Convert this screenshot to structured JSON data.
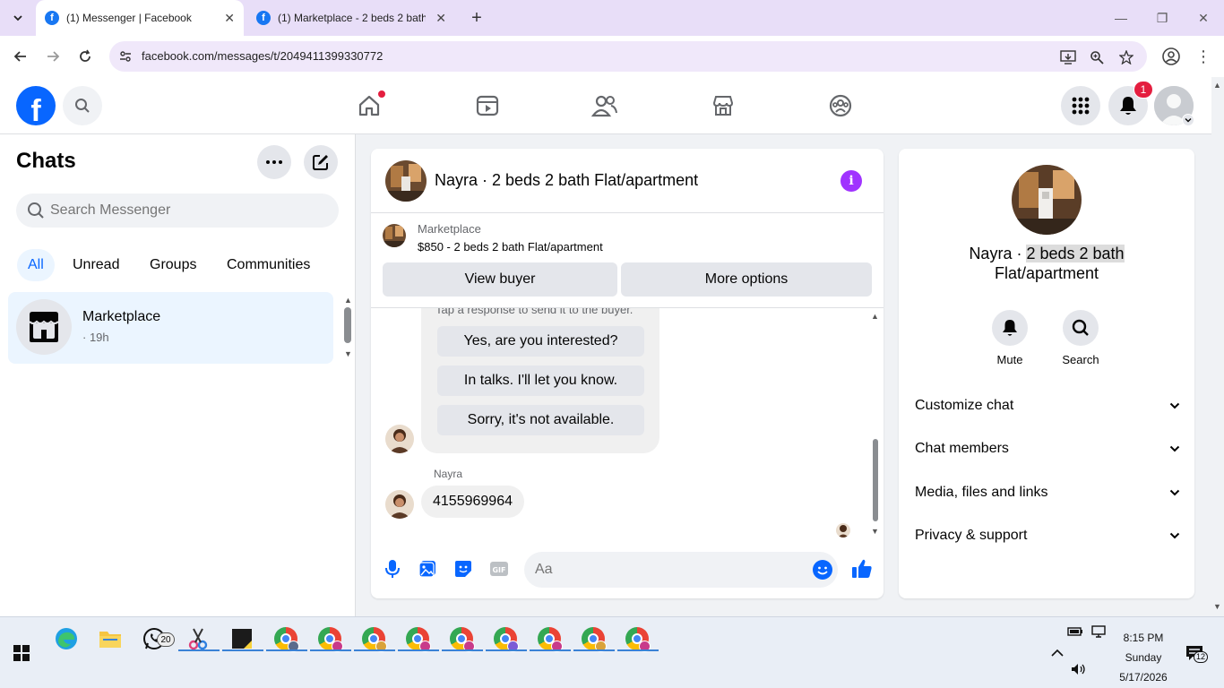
{
  "browser": {
    "tabs": [
      {
        "title": "(1) Messenger | Facebook",
        "active": true
      },
      {
        "title": "(1) Marketplace - 2 beds 2 bath",
        "active": false
      }
    ],
    "url": "facebook.com/messages/t/2049411399330772"
  },
  "fb": {
    "notifications_count": "1"
  },
  "left": {
    "title": "Chats",
    "search_placeholder": "Search Messenger",
    "filters": [
      "All",
      "Unread",
      "Groups",
      "Communities"
    ],
    "chats": [
      {
        "name": "Marketplace",
        "time": "· 19h"
      }
    ]
  },
  "conversation": {
    "title": "Nayra · 2 beds 2 bath Flat/apartment",
    "banner": {
      "label": "Marketplace",
      "item": "$850 - 2 beds 2 bath Flat/apartment",
      "view_buyer": "View buyer",
      "more_options": "More options"
    },
    "tap_hint": "Tap a response to send it to the buyer.",
    "quick_replies": [
      "Yes, are you interested?",
      "In talks. I'll let you know.",
      "Sorry, it's not available."
    ],
    "sender": "Nayra",
    "last_message": "4155969964",
    "composer_placeholder": "Aa"
  },
  "info": {
    "name_prefix": "Nayra · ",
    "name_highlight": "2 beds 2 bath",
    "name_suffix": "Flat/apartment",
    "actions": [
      "Mute",
      "Search"
    ],
    "sections": [
      "Customize chat",
      "Chat members",
      "Media, files and links",
      "Privacy & support"
    ]
  },
  "taskbar": {
    "whatsapp_badge": "20",
    "time": "8:15 PM",
    "day": "Sunday",
    "date": "5/17/2026",
    "notif_count": "12"
  },
  "colors": {
    "fb_blue": "#0866ff",
    "info_purple": "#a033ff",
    "badge_red": "#e41e3f"
  }
}
